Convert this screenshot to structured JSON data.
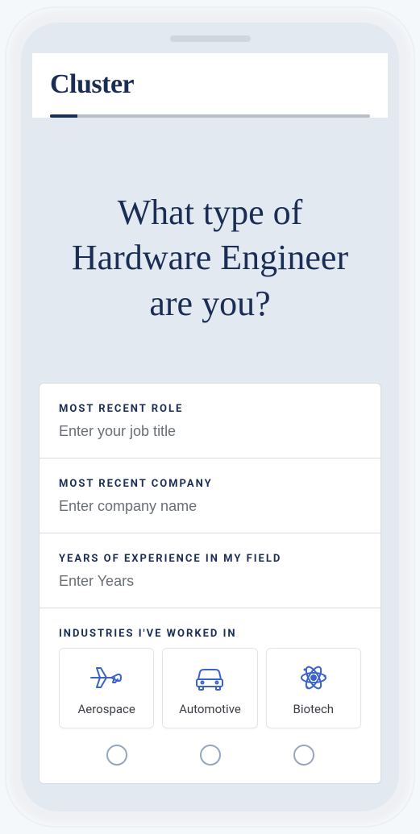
{
  "header": {
    "logo": "Cluster"
  },
  "hero": {
    "title": "What type of Hardware Engineer are you?"
  },
  "form": {
    "role": {
      "label": "MOST RECENT ROLE",
      "placeholder": "Enter your job title"
    },
    "company": {
      "label": "MOST RECENT COMPANY",
      "placeholder": "Enter company name"
    },
    "years": {
      "label": "YEARS OF EXPERIENCE IN MY FIELD",
      "placeholder": "Enter Years"
    },
    "industries": {
      "label": "INDUSTRIES I'VE WORKED IN",
      "options": [
        {
          "name": "Aerospace"
        },
        {
          "name": "Automotive"
        },
        {
          "name": "Biotech"
        }
      ]
    }
  },
  "colors": {
    "brand": "#1a2d55",
    "iconBlue": "#3a62c9"
  }
}
